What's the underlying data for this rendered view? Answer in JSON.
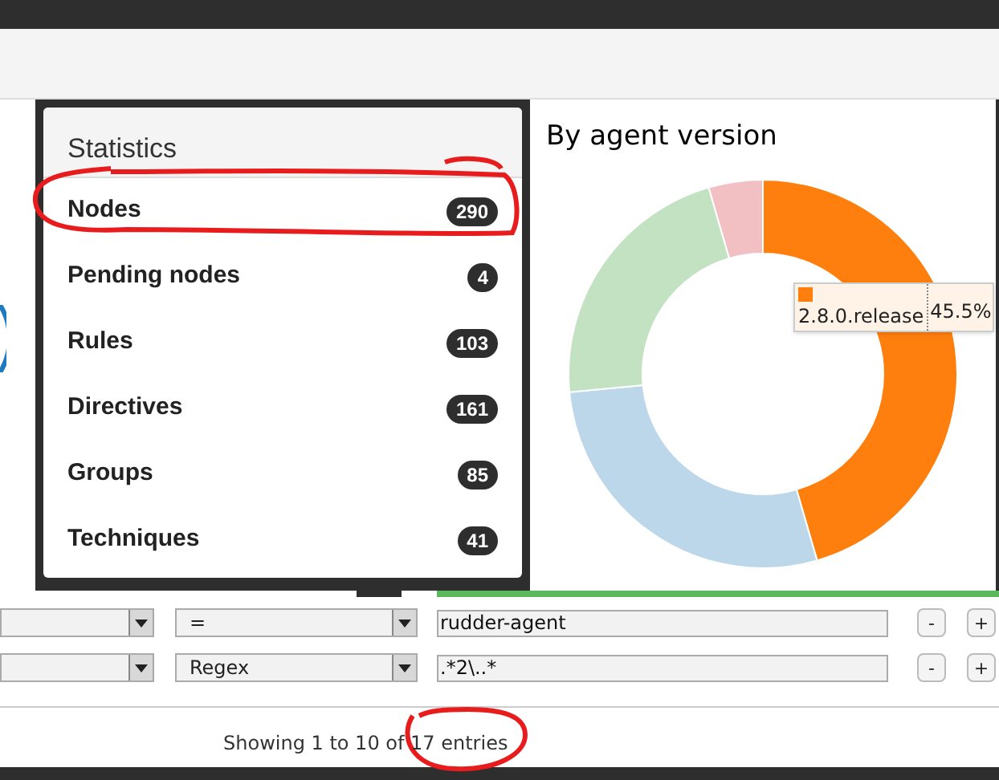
{
  "statistics": {
    "title": "Statistics",
    "items": [
      {
        "label": "Nodes",
        "count": "290",
        "highlighted": true
      },
      {
        "label": "Pending nodes",
        "count": "4",
        "highlighted": false
      },
      {
        "label": "Rules",
        "count": "103",
        "highlighted": false
      },
      {
        "label": "Directives",
        "count": "161",
        "highlighted": false
      },
      {
        "label": "Groups",
        "count": "85",
        "highlighted": false
      },
      {
        "label": "Techniques",
        "count": "41",
        "highlighted": false
      }
    ]
  },
  "chart": {
    "title": "By agent version",
    "tooltip": {
      "label": "2.8.0.release",
      "value": "45.5%",
      "color": "#ff7f0e"
    }
  },
  "filters": [
    {
      "operator": "=",
      "value": "rudder-agent",
      "buttons": [
        "-",
        "+"
      ]
    },
    {
      "operator": "Regex",
      "value": ".*2\\..*",
      "buttons": [
        "-",
        "+"
      ]
    }
  ],
  "footer": {
    "info_parts": [
      "Showing 1 to 10 of ",
      "17 entries"
    ],
    "highlighted": true
  }
}
